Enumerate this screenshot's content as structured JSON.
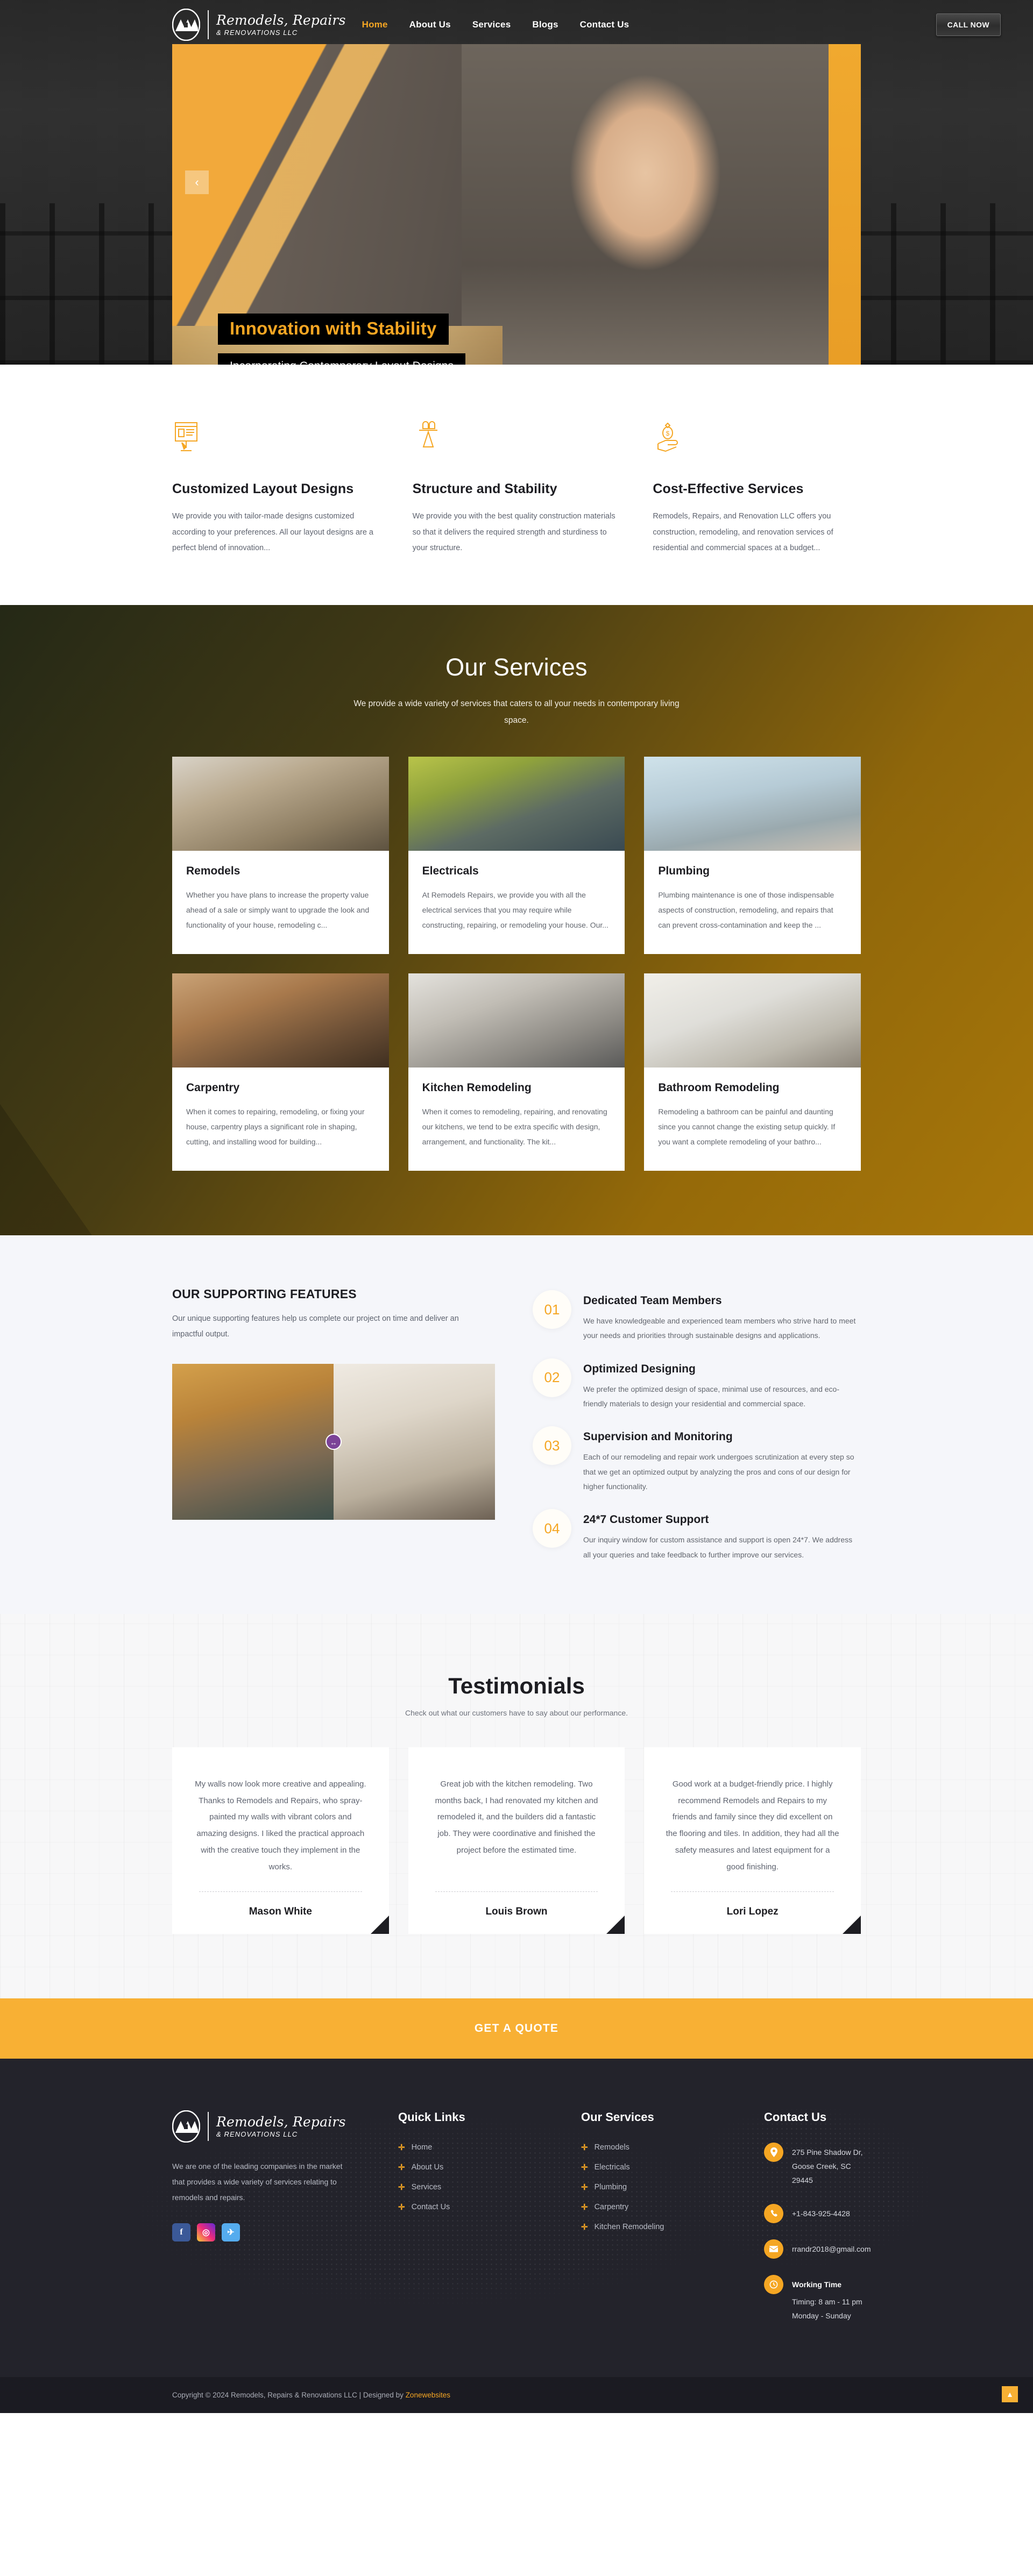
{
  "brand": {
    "name_line1": "Remodels, Repairs",
    "name_line2": "& RENOVATIONS LLC",
    "monogram": "RRR"
  },
  "nav": {
    "items": [
      {
        "label": "Home",
        "active": true
      },
      {
        "label": "About Us",
        "active": false
      },
      {
        "label": "Services",
        "active": false
      },
      {
        "label": "Blogs",
        "active": false
      },
      {
        "label": "Contact Us",
        "active": false
      }
    ],
    "call_button": "CALL NOW"
  },
  "hero": {
    "title": "Innovation with Stability",
    "subtitle": "Incorporating Contemporary Layout Designs",
    "prev_arrow": "‹"
  },
  "features": [
    {
      "icon": "layout-design-icon",
      "title": "Customized Layout Designs",
      "desc": "We provide you with tailor-made designs customized according to your preferences. All our layout designs are a perfect blend of innovation..."
    },
    {
      "icon": "structure-stability-icon",
      "title": "Structure and Stability",
      "desc": "We provide you with the best quality construction materials so that it delivers the required strength and sturdiness to your structure."
    },
    {
      "icon": "cost-effective-icon",
      "title": "Cost-Effective Services",
      "desc": "Remodels, Repairs, and Renovation LLC offers you construction, remodeling, and renovation services of residential and commercial spaces at a budget..."
    }
  ],
  "services": {
    "title": "Our Services",
    "subtitle": "We provide a wide variety of services that caters to all your needs in contemporary living space.",
    "cards": [
      {
        "name": "Remodels",
        "text": "Whether you have plans to increase the property value ahead of a sale or simply want to upgrade the look and functionality of your house, remodeling c...",
        "photo": "ph-remodels"
      },
      {
        "name": "Electricals",
        "text": "At Remodels Repairs, we provide you with all the electrical services that you may require while constructing, repairing, or remodeling your house. Our...",
        "photo": "ph-electrical"
      },
      {
        "name": "Plumbing",
        "text": "Plumbing maintenance is one of those indispensable aspects of construction, remodeling, and repairs that can prevent cross-contamination and keep the ...",
        "photo": "ph-plumbing"
      },
      {
        "name": "Carpentry",
        "text": "When it comes to repairing, remodeling, or fixing your house, carpentry plays a significant role in shaping, cutting, and installing wood for building...",
        "photo": "ph-carpentry"
      },
      {
        "name": "Kitchen Remodeling",
        "text": "When it comes to remodeling, repairing, and renovating our kitchens, we tend to be extra specific with design, arrangement, and functionality. The kit...",
        "photo": "ph-kitchen"
      },
      {
        "name": "Bathroom Remodeling",
        "text": "Remodeling a bathroom can be painful and daunting since you cannot change the existing setup quickly. If you want a complete remodeling of your bathro...",
        "photo": "ph-bathroom"
      }
    ]
  },
  "support": {
    "kicker": "OUR SUPPORTING FEATURES",
    "lead": "Our unique supporting features help us complete our project on time and deliver an impactful output.",
    "slider_handle": "↔",
    "steps": [
      {
        "num": "01",
        "title": "Dedicated Team Members",
        "text": "We have knowledgeable and experienced team members who strive hard to meet your needs and priorities through sustainable designs and applications."
      },
      {
        "num": "02",
        "title": "Optimized Designing",
        "text": "We prefer the optimized design of space, minimal use of resources, and eco-friendly materials to design your residential and commercial space."
      },
      {
        "num": "03",
        "title": "Supervision and Monitoring",
        "text": "Each of our remodeling and repair work undergoes scrutinization at every step so that we get an optimized output by analyzing the pros and cons of our design for higher functionality."
      },
      {
        "num": "04",
        "title": "24*7 Customer Support",
        "text": "Our inquiry window for custom assistance and support is open 24*7. We address all your queries and take feedback to further improve our services."
      }
    ]
  },
  "testimonials": {
    "title": "Testimonials",
    "subtitle": "Check out what our customers have to say about our performance.",
    "items": [
      {
        "quote": "My walls now look more creative and appealing. Thanks to Remodels and Repairs, who spray-painted my walls with vibrant colors and amazing designs. I liked the practical approach with the creative touch they implement in the works.",
        "name": "Mason White"
      },
      {
        "quote": "Great job with the kitchen remodeling. Two months back, I had renovated my kitchen and remodeled it, and the builders did a fantastic job. They were coordinative and finished the project before the estimated time.",
        "name": "Louis Brown"
      },
      {
        "quote": "Good work at a budget-friendly price. I highly recommend Remodels and Repairs to my friends and family since they did excellent on the flooring and tiles. In addition, they had all the safety measures and latest equipment for a good finishing.",
        "name": "Lori Lopez"
      }
    ]
  },
  "cta": {
    "label": "GET A QUOTE"
  },
  "footer": {
    "about": "We are one of the leading companies in the market that provides a wide variety of services relating to remodels and repairs.",
    "socials": [
      {
        "name": "facebook-icon",
        "glyph": "f"
      },
      {
        "name": "instagram-icon",
        "glyph": "◎"
      },
      {
        "name": "twitter-icon",
        "glyph": "✈"
      }
    ],
    "quick_links": {
      "heading": "Quick Links",
      "items": [
        "Home",
        "About Us",
        "Services",
        "Contact Us"
      ]
    },
    "our_services": {
      "heading": "Our Services",
      "items": [
        "Remodels",
        "Electricals",
        "Plumbing",
        "Carpentry",
        "Kitchen Remodeling"
      ]
    },
    "contact": {
      "heading": "Contact Us",
      "address": "275 Pine Shadow Dr, Goose Creek, SC 29445",
      "phone": "+1-843-925-4428",
      "email": "rrandr2018@gmail.com",
      "working_title": "Working Time",
      "working_hours": "Timing: 8 am - 11 pm",
      "working_days": "Monday - Sunday"
    },
    "copyright_text": "Copyright © 2024 Remodels, Repairs & Renovations LLC | Designed by ",
    "designer": "Zonewebsites",
    "scroll_top": "▲"
  },
  "colors": {
    "accent": "#f5a623",
    "cta": "#f8b034",
    "dark": "#23232b"
  }
}
